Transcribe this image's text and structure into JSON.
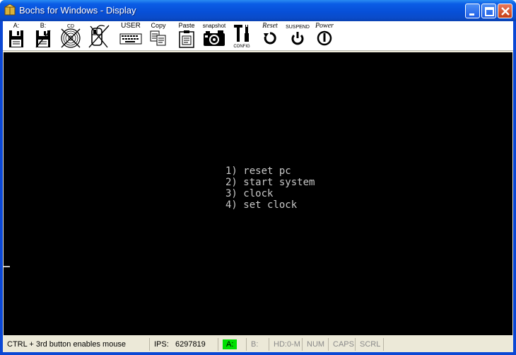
{
  "window": {
    "title": "Bochs for Windows - Display"
  },
  "toolbar": {
    "floppy_a": "A:",
    "floppy_b": "B:",
    "cdrom": "CD",
    "user": "USER",
    "copy": "Copy",
    "paste": "Paste",
    "snapshot": "snapshot",
    "config": "CONFIG",
    "reset": "Reset",
    "suspend": "SUSPEND",
    "power": "Power"
  },
  "screen": {
    "menu": [
      "1) reset pc",
      "2) start system",
      "3) clock",
      "4) set clock"
    ]
  },
  "status": {
    "message": "CTRL + 3rd button enables mouse",
    "ips_label": "IPS:",
    "ips_value": "6297819",
    "drive_a": "A:",
    "drive_b": "B:",
    "hd": "HD:0-M",
    "num": "NUM",
    "caps": "CAPS",
    "scrl": "SCRL"
  },
  "colors": {
    "titlebar": "#0a4bc8",
    "screen_bg": "#000000",
    "screen_text": "#c8c8c8",
    "drive_active": "#00e000"
  }
}
